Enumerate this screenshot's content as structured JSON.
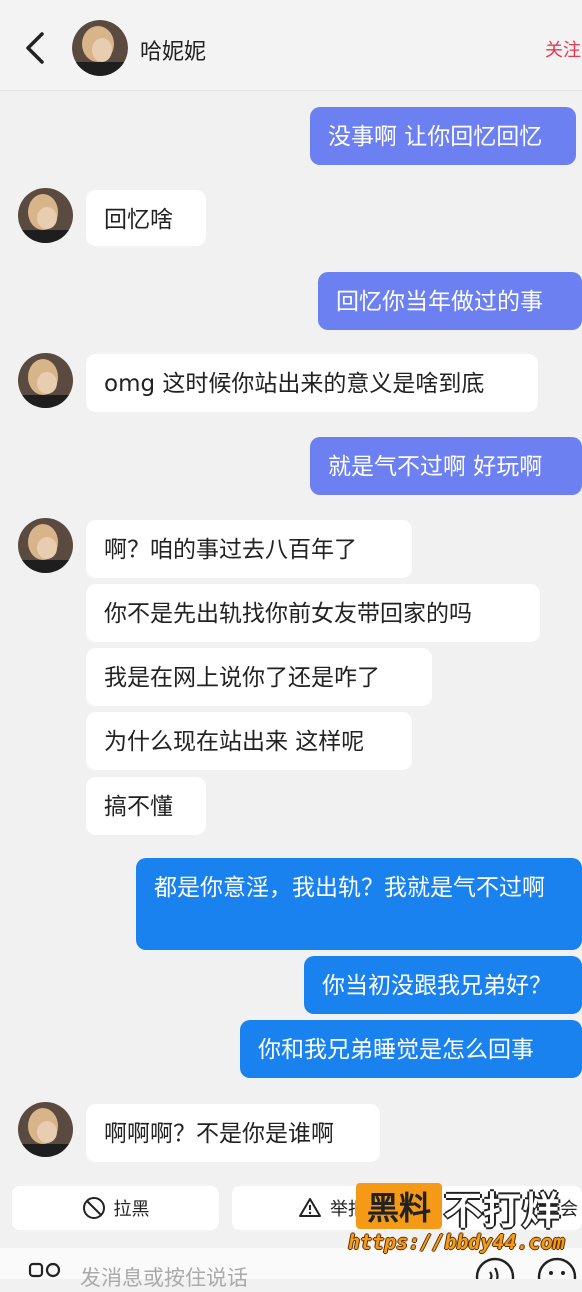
{
  "header": {
    "contact_name": "哈妮妮",
    "follow_label": "关注"
  },
  "messages": [
    {
      "side": "out",
      "text": "没事啊 让你回忆回忆"
    },
    {
      "side": "in",
      "text": "回忆啥"
    },
    {
      "side": "out",
      "text": "回忆你当年做过的事"
    },
    {
      "side": "in",
      "text": "omg 这时候你站出来的意义是啥到底"
    },
    {
      "side": "out",
      "text": "就是气不过啊 好玩啊"
    },
    {
      "side": "in",
      "text": "啊？咱的事过去八百年了"
    },
    {
      "side": "in",
      "text": "你不是先出轨找你前女友带回家的吗"
    },
    {
      "side": "in",
      "text": "我是在网上说你了还是咋了"
    },
    {
      "side": "in",
      "text": "为什么现在站出来 这样呢"
    },
    {
      "side": "in",
      "text": "搞不懂"
    },
    {
      "side": "out",
      "text": "都是你意淫，我出轨？我就是气不过啊"
    },
    {
      "side": "out",
      "text": "你当初没跟我兄弟好？"
    },
    {
      "side": "out",
      "text": "你和我兄弟睡觉是怎么回事"
    },
    {
      "side": "in",
      "text": "啊啊啊？不是你是谁啊"
    }
  ],
  "actions": {
    "block_label": "拉黑",
    "report_label": "举报",
    "delete_label": "除会"
  },
  "input": {
    "placeholder": "发消息或按住说话"
  },
  "watermark": {
    "logo_text": "黑料",
    "text": "不打烊",
    "url": "https://bbdy44.com"
  },
  "colors": {
    "purple_bubble": "#6c80f1",
    "blue_bubble": "#1a82ee",
    "follow_red": "#e8384f",
    "watermark_orange": "#f59a17"
  },
  "icons": [
    "back-arrow-icon",
    "block-icon",
    "warning-icon",
    "grid-icon",
    "voice-icon",
    "emoji-icon"
  ]
}
